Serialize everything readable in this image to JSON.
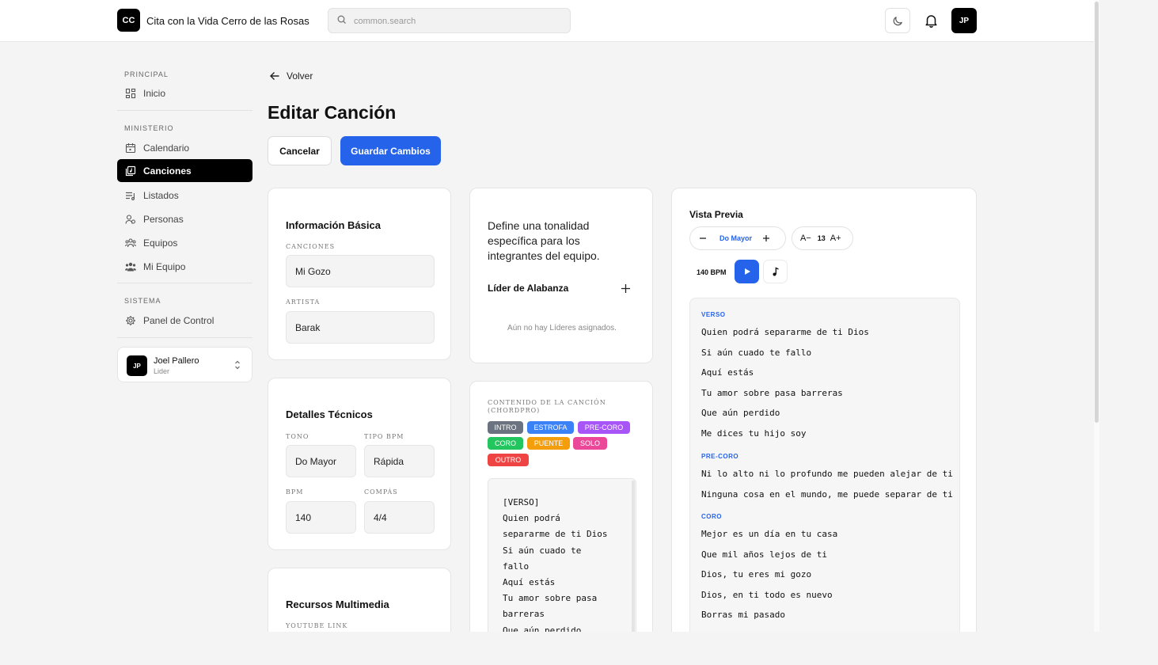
{
  "header": {
    "logo_initials": "CC",
    "app_title": "Cita con la Vida Cerro de las Rosas",
    "search_placeholder": "common.search",
    "user_initials": "JP"
  },
  "sidebar": {
    "sections": [
      {
        "title": "PRINCIPAL",
        "items": [
          {
            "label": "Inicio",
            "icon": "grid-icon"
          }
        ]
      },
      {
        "title": "MINISTERIO",
        "items": [
          {
            "label": "Calendario",
            "icon": "calendar-icon"
          },
          {
            "label": "Canciones",
            "icon": "songs-icon",
            "active": true
          },
          {
            "label": "Listados",
            "icon": "playlist-icon"
          },
          {
            "label": "Personas",
            "icon": "people-icon"
          },
          {
            "label": "Equipos",
            "icon": "teams-icon"
          },
          {
            "label": "Mi Equipo",
            "icon": "my-team-icon"
          }
        ]
      },
      {
        "title": "SISTEMA",
        "items": [
          {
            "label": "Panel de Control",
            "icon": "gear-icon"
          }
        ]
      }
    ],
    "user": {
      "initials": "JP",
      "name": "Joel Pallero",
      "role": "Lider"
    }
  },
  "main": {
    "back_label": "Volver",
    "title": "Editar Canción",
    "cancel_label": "Cancelar",
    "save_label": "Guardar Cambios"
  },
  "basic_info": {
    "title": "Información Básica",
    "song_label": "CANCIONES",
    "song_value": "Mi Gozo",
    "artist_label": "ARTISTA",
    "artist_value": "Barak"
  },
  "technical": {
    "title": "Detalles Técnicos",
    "tono_label": "TONO",
    "tono_value": "Do Mayor",
    "tipo_label": "TIPO BPM",
    "tipo_value": "Rápida",
    "bpm_label": "BPM",
    "bpm_value": "140",
    "compas_label": "COMPÁS",
    "compas_value": "4/4"
  },
  "multimedia": {
    "title": "Recursos Multimedia",
    "youtube_label": "YOUTUBE LINK"
  },
  "tonality": {
    "description": "Define una tonalidad específica para los integrantes del equipo.",
    "leader_title": "Líder de Alabanza",
    "empty_text": "Aún no hay Líderes asignados."
  },
  "chordpro": {
    "label": "CONTENIDO DE LA CANCIÓN (CHORDPRO)",
    "tags": [
      {
        "label": "INTRO",
        "color": "#6b7280"
      },
      {
        "label": "ESTROFA",
        "color": "#3b82f6"
      },
      {
        "label": "PRE-CORO",
        "color": "#a855f7"
      },
      {
        "label": "CORO",
        "color": "#22c55e"
      },
      {
        "label": "PUENTE",
        "color": "#f59e0b"
      },
      {
        "label": "SOLO",
        "color": "#ec4899"
      },
      {
        "label": "OUTRO",
        "color": "#ef4444"
      }
    ],
    "content": "[VERSO]\nQuien podrá\nsepararme de ti Dios\nSi aún cuado te\nfallo\nAquí estás\nTu amor sobre pasa\nbarreras\nQue aún perdido"
  },
  "preview": {
    "title": "Vista Previa",
    "key": "Do Mayor",
    "font_decrease": "A−",
    "font_size": "13",
    "font_increase": "A+",
    "bpm": "140 BPM",
    "accent_color": "#2563eb",
    "sections": [
      {
        "name": "VERSO",
        "lines": [
          "Quien podrá separarme de ti Dios",
          "Si aún cuado te fallo",
          "Aquí estás",
          "Tu amor sobre pasa barreras",
          "Que aún perdido",
          "Me dices tu hijo soy"
        ]
      },
      {
        "name": "PRE-CORO",
        "lines": [
          "Ni lo alto ni lo profundo me pueden alejar de ti",
          "Ninguna cosa en el mundo, me puede separar de ti"
        ]
      },
      {
        "name": "CORO",
        "lines": [
          "Mejor es un día en tu casa",
          "Que mil años lejos de ti",
          "Dios, tu eres mi gozo",
          "Dios, en ti todo es nuevo",
          "Borras mi pasado"
        ]
      }
    ]
  }
}
